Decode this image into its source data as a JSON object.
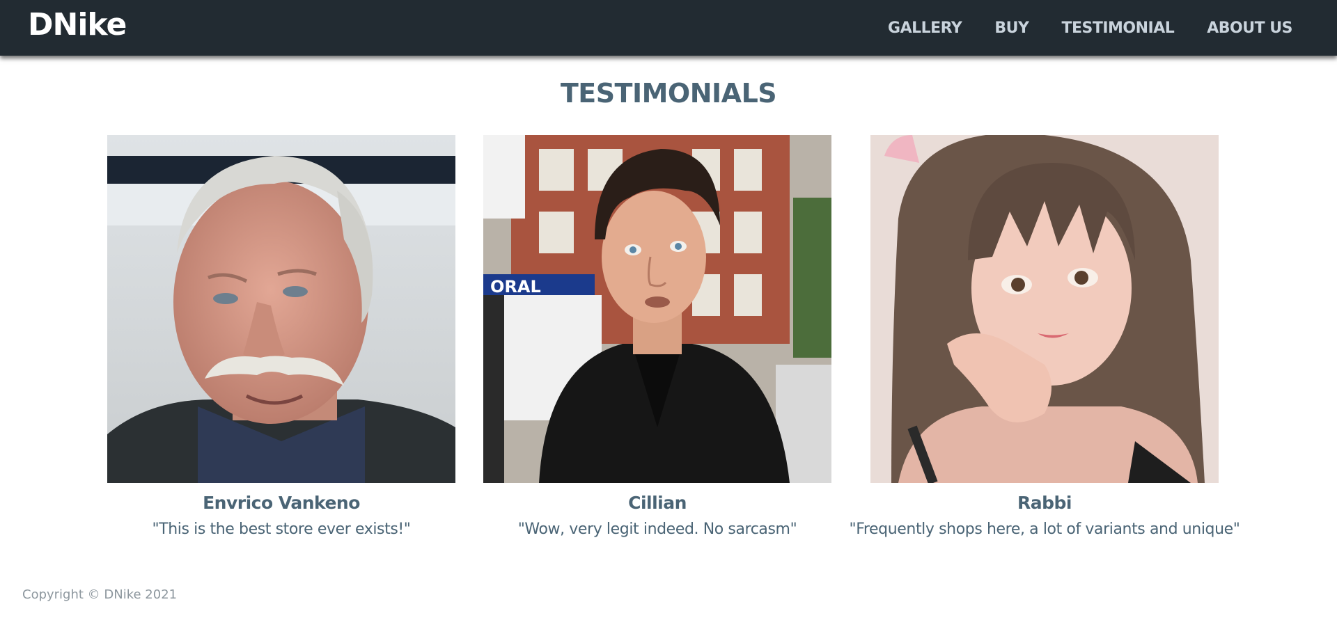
{
  "brand": {
    "logo": "DNike"
  },
  "nav": {
    "items": [
      {
        "label": "GALLERY"
      },
      {
        "label": "BUY"
      },
      {
        "label": "TESTIMONIAL"
      },
      {
        "label": "ABOUT US"
      }
    ]
  },
  "testimonials": {
    "title": "TESTIMONIALS",
    "items": [
      {
        "name": "Envrico Vankeno",
        "quote": "\"This is the best store ever exists!\"",
        "photo": "photo-older-man-mustache"
      },
      {
        "name": "Cillian",
        "quote": "\"Wow, very legit indeed. No sarcasm\"",
        "photo": "photo-man-dark-jacket-street"
      },
      {
        "name": "Rabbi",
        "quote": "\"Frequently shops here, a lot of variants and unique\"",
        "photo": "photo-woman-long-hair"
      }
    ]
  },
  "footer": {
    "copyright": "Copyright © DNike 2021"
  },
  "colors": {
    "navbar_bg": "#222b32",
    "nav_text": "#c9d3dc",
    "heading_text": "#4a6475",
    "footer_text": "#8d979e"
  }
}
